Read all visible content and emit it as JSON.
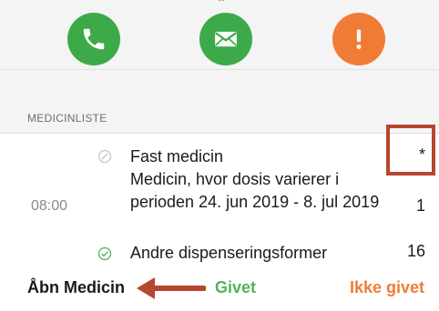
{
  "actions": [
    {
      "icon": "phone-icon",
      "color": "#3daa4a"
    },
    {
      "icon": "mail-icon",
      "color": "#3daa4a"
    },
    {
      "icon": "exclamation-icon",
      "color": "#f07b35"
    }
  ],
  "section": {
    "title": "MEDICINLISTE"
  },
  "list": {
    "time": "08:00",
    "items": [
      {
        "text": "Fast medicin",
        "count": "*",
        "status_icon": "slash-circle-icon"
      },
      {
        "text": "Medicin, hvor dosis varierer i perioden 24. jun 2019 - 8. jul 2019",
        "count": "1"
      },
      {
        "text": "Andre dispenseringsformer",
        "count": "16",
        "status_icon": "check-circle-icon"
      }
    ]
  },
  "bottom": {
    "open_label": "Åbn Medicin",
    "given_label": "Givet",
    "not_given_label": "Ikke givet"
  },
  "annotation": {
    "color": "#b5462f"
  }
}
